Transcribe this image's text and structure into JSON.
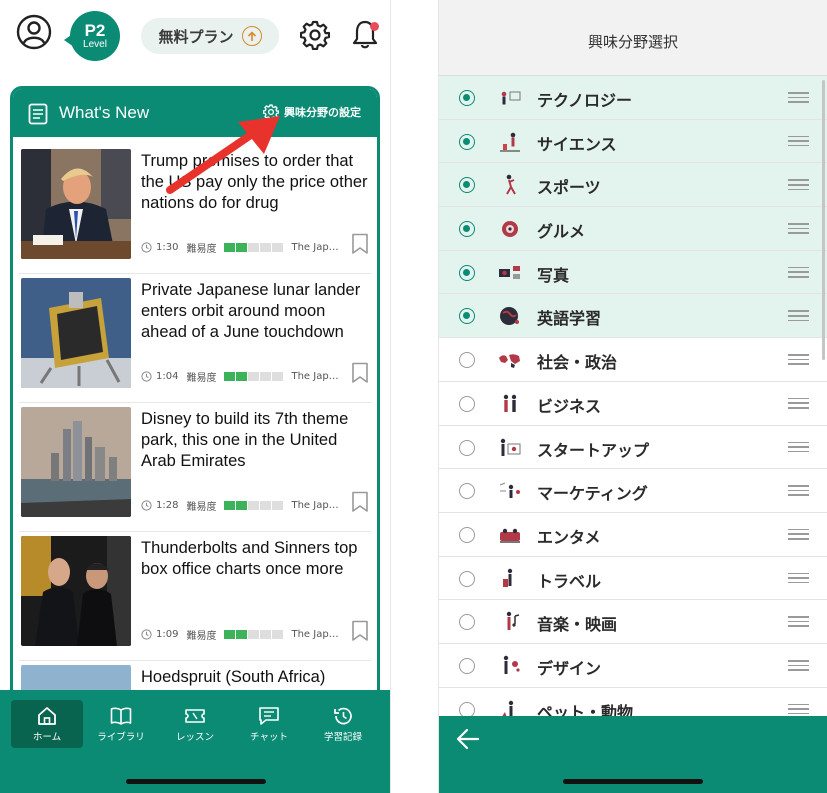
{
  "left_screen": {
    "level": {
      "main": "P2",
      "sub": "Level"
    },
    "plan_label": "無料プラン",
    "colors": {
      "accent": "#0b8a74",
      "badge": "#e74c5a",
      "difficulty": "#3cb35a"
    },
    "whats_new": {
      "title": "What's New",
      "interest_settings_label": "興味分野の設定"
    },
    "news": [
      {
        "headline": "Trump promises to order that the US pay only the price other nations do for drug",
        "duration": "1:30",
        "difficulty_label": "難易度",
        "level": 0.4,
        "source": "The Japan Times"
      },
      {
        "headline": "Private Japanese lunar lander enters orbit around moon ahead of a June touchdown",
        "duration": "1:04",
        "difficulty_label": "難易度",
        "level": 0.4,
        "source": "The Japan Times"
      },
      {
        "headline": "Disney to build its 7th theme park, this one in the United Arab Emirates",
        "duration": "1:28",
        "difficulty_label": "難易度",
        "level": 0.4,
        "source": "The Japan Times"
      },
      {
        "headline": "Thunderbolts and Sinners top box office charts once more",
        "duration": "1:09",
        "difficulty_label": "難易度",
        "level": 0.4,
        "source": "The Japan Times"
      },
      {
        "headline": "Hoedspruit (South Africa)",
        "duration": "",
        "difficulty_label": "",
        "level": 0,
        "source": ""
      }
    ],
    "nav": [
      {
        "label": "ホーム",
        "icon": "home-icon"
      },
      {
        "label": "ライブラリ",
        "icon": "book-icon"
      },
      {
        "label": "レッスン",
        "icon": "ticket-icon"
      },
      {
        "label": "チャット",
        "icon": "chat-icon"
      },
      {
        "label": "学習記録",
        "icon": "history-icon"
      }
    ]
  },
  "right_screen": {
    "title": "興味分野選択",
    "categories": [
      {
        "label": "テクノロジー",
        "selected": true
      },
      {
        "label": "サイエンス",
        "selected": true
      },
      {
        "label": "スポーツ",
        "selected": true
      },
      {
        "label": "グルメ",
        "selected": true
      },
      {
        "label": "写真",
        "selected": true
      },
      {
        "label": "英語学習",
        "selected": true
      },
      {
        "label": "社会・政治",
        "selected": false
      },
      {
        "label": "ビジネス",
        "selected": false
      },
      {
        "label": "スタートアップ",
        "selected": false
      },
      {
        "label": "マーケティング",
        "selected": false
      },
      {
        "label": "エンタメ",
        "selected": false
      },
      {
        "label": "トラベル",
        "selected": false
      },
      {
        "label": "音楽・映画",
        "selected": false
      },
      {
        "label": "デザイン",
        "selected": false
      },
      {
        "label": "ペット・動物",
        "selected": false
      }
    ]
  }
}
